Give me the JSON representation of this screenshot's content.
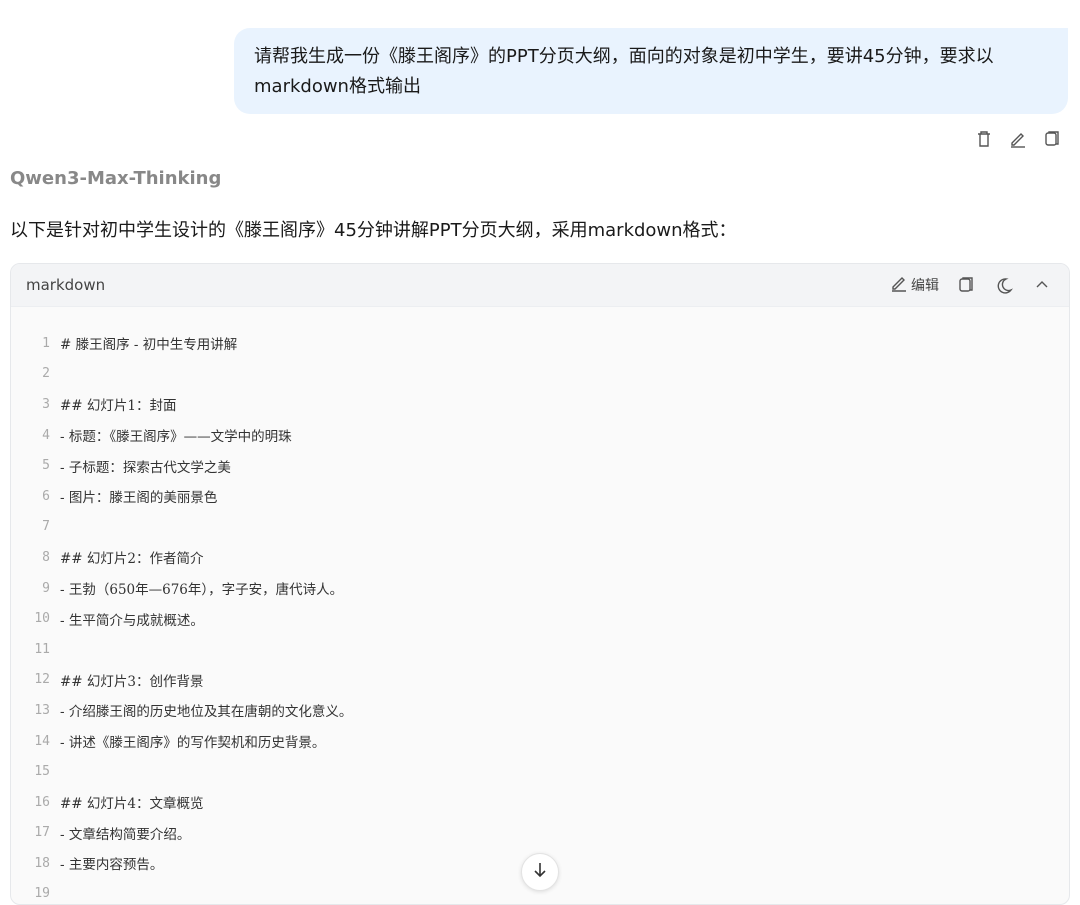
{
  "user_message": {
    "line1": "请帮我生成一份《滕王阁序》的PPT分页大纲，面向的对象是初中学生，要讲45分钟，要求以",
    "line2": "markdown格式输出"
  },
  "message_actions": {
    "icons": [
      "delete-icon",
      "edit-icon",
      "copy-icon"
    ]
  },
  "assistant": {
    "model_name": "Qwen3-Max-Thinking",
    "intro": "以下是针对初中学生设计的《滕王阁序》45分钟讲解PPT分页大纲，采用markdown格式："
  },
  "code_block": {
    "language": "markdown",
    "edit_label": "编辑",
    "tool_icons": [
      "edit-icon",
      "copy-icon",
      "theme-toggle-icon",
      "collapse-icon"
    ],
    "lines": [
      {
        "n": "1",
        "text": "# 滕王阁序 - 初中生专用讲解"
      },
      {
        "n": "2",
        "text": ""
      },
      {
        "n": "3",
        "text": "## 幻灯片1：封面"
      },
      {
        "n": "4",
        "text": "- 标题：《滕王阁序》——文学中的明珠"
      },
      {
        "n": "5",
        "text": "- 子标题：探索古代文学之美"
      },
      {
        "n": "6",
        "text": "- 图片：滕王阁的美丽景色"
      },
      {
        "n": "7",
        "text": ""
      },
      {
        "n": "8",
        "text": "## 幻灯片2：作者简介"
      },
      {
        "n": "9",
        "text": "- 王勃（650年—676年），字子安，唐代诗人。"
      },
      {
        "n": "10",
        "text": "- 生平简介与成就概述。"
      },
      {
        "n": "11",
        "text": ""
      },
      {
        "n": "12",
        "text": "## 幻灯片3：创作背景"
      },
      {
        "n": "13",
        "text": "- 介绍滕王阁的历史地位及其在唐朝的文化意义。"
      },
      {
        "n": "14",
        "text": "- 讲述《滕王阁序》的写作契机和历史背景。"
      },
      {
        "n": "15",
        "text": ""
      },
      {
        "n": "16",
        "text": "## 幻灯片4：文章概览"
      },
      {
        "n": "17",
        "text": "- 文章结构简要介绍。"
      },
      {
        "n": "18",
        "text": "- 主要内容预告。"
      },
      {
        "n": "19",
        "text": ""
      }
    ]
  },
  "scroll_button": {
    "icon": "arrow-down-icon"
  }
}
